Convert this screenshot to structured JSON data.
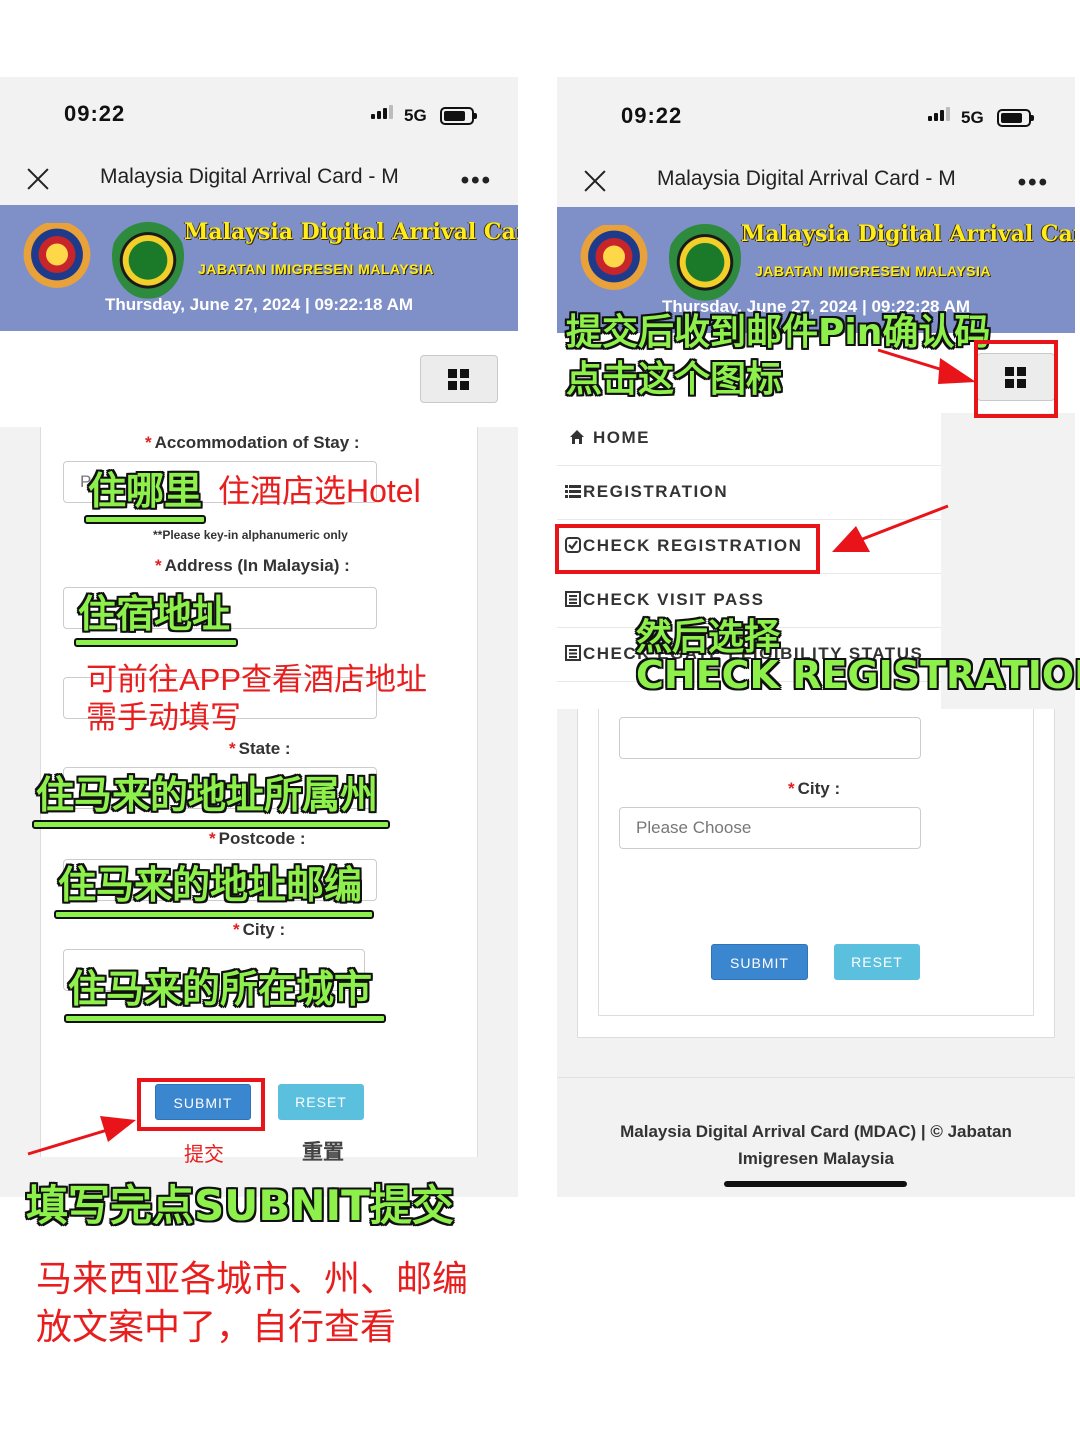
{
  "status": {
    "time": "09:22",
    "network": "5G"
  },
  "nav": {
    "title": "Malaysia Digital Arrival Card - M",
    "more": "•••"
  },
  "banner": {
    "title": "Malaysia Digital Arrival Card",
    "subtitle": "JABATAN IMIGRESEN MALAYSIA",
    "date_left": "Thursday, June 27, 2024 | 09:22:18 AM",
    "date_right": "Thursday, June 27, 2024 | 09:22:28 AM"
  },
  "form_left": {
    "accommodation_label": "Accommodation of Stay :",
    "accommodation_value": "P",
    "hint": "**Please key-in alphanumeric only",
    "address_label": "Address (In Malaysia) :",
    "state_label": "State :",
    "postcode_label": "Postcode :",
    "city_label": "City :",
    "submit": "SUBMIT",
    "reset": "RESET",
    "required_mark": "*"
  },
  "menu": {
    "items": [
      {
        "label": "HOME",
        "icon": "home-icon"
      },
      {
        "label": "REGISTRATION",
        "icon": "list-icon"
      },
      {
        "label": "CHECK REGISTRATION",
        "icon": "check-square-icon"
      },
      {
        "label": "CHECK VISIT PASS",
        "icon": "document-icon"
      },
      {
        "label": "CHECK EGATE ELIGIBILITY STATUS",
        "icon": "document-icon"
      }
    ]
  },
  "form_right": {
    "city_label": "City :",
    "city_placeholder": "Please Choose",
    "submit": "SUBMIT",
    "reset": "RESET"
  },
  "footer": {
    "line1": "Malaysia Digital Arrival Card (MDAC) | © Jabatan",
    "line2": "Imigresen Malaysia"
  },
  "annotations": {
    "where_stay": "住哪里",
    "hotel_choose": "住酒店选Hotel",
    "address": "住宿地址",
    "app_address_1": "可前往APP查看酒店地址",
    "app_address_2": "需手动填写",
    "state": "住马来的地址所属州",
    "postcode": "住马来的地址邮编",
    "city": "住马来的所在城市",
    "submit_cn": "提交",
    "reset_cn": "重置",
    "fill_submit": "填写完点SUBNIT提交",
    "note_1": "马来西亚各城市、州、邮编",
    "note_2": "放文案中了，自行查看",
    "pin_1": "提交后收到邮件Pin确认码",
    "pin_2": "点击这个图标",
    "then_choose": "然后选择",
    "check_reg": "CHECK REGISTRATION"
  },
  "colors": {
    "banner": "#7f8fc8",
    "annotation_green": "#8ef04a",
    "annotation_red": "#e81e1e",
    "submit": "#3a86cf",
    "reset": "#5bc0de"
  }
}
